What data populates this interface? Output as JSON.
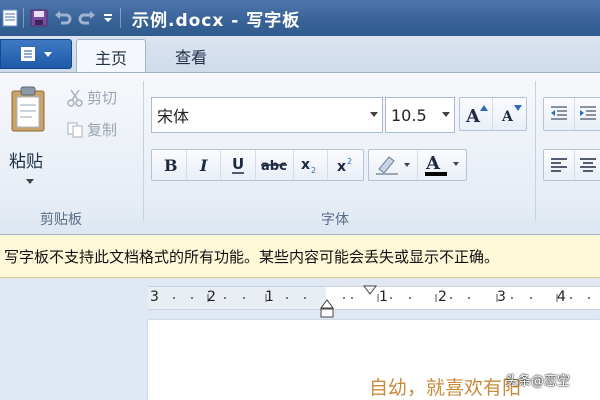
{
  "window": {
    "title": "示例.docx - 写字板"
  },
  "tabs": [
    {
      "label": "主页"
    },
    {
      "label": "查看"
    }
  ],
  "clipboard": {
    "paste_label": "粘贴",
    "cut_label": "剪切",
    "copy_label": "复制",
    "group_label": "剪贴板"
  },
  "font": {
    "family": "宋体",
    "size": "10.5",
    "group_label": "字体",
    "text_color": "#000000"
  },
  "message_bar": {
    "text": "写字板不支持此文档格式的所有功能。某些内容可能会丢失或显示不正确。"
  },
  "ruler": {
    "ticks": [
      "3",
      "2",
      "1",
      "1",
      "2",
      "3",
      "4"
    ]
  },
  "document": {
    "body_text": "自幼，就喜欢有阳"
  },
  "watermark": "头条@恋空"
}
